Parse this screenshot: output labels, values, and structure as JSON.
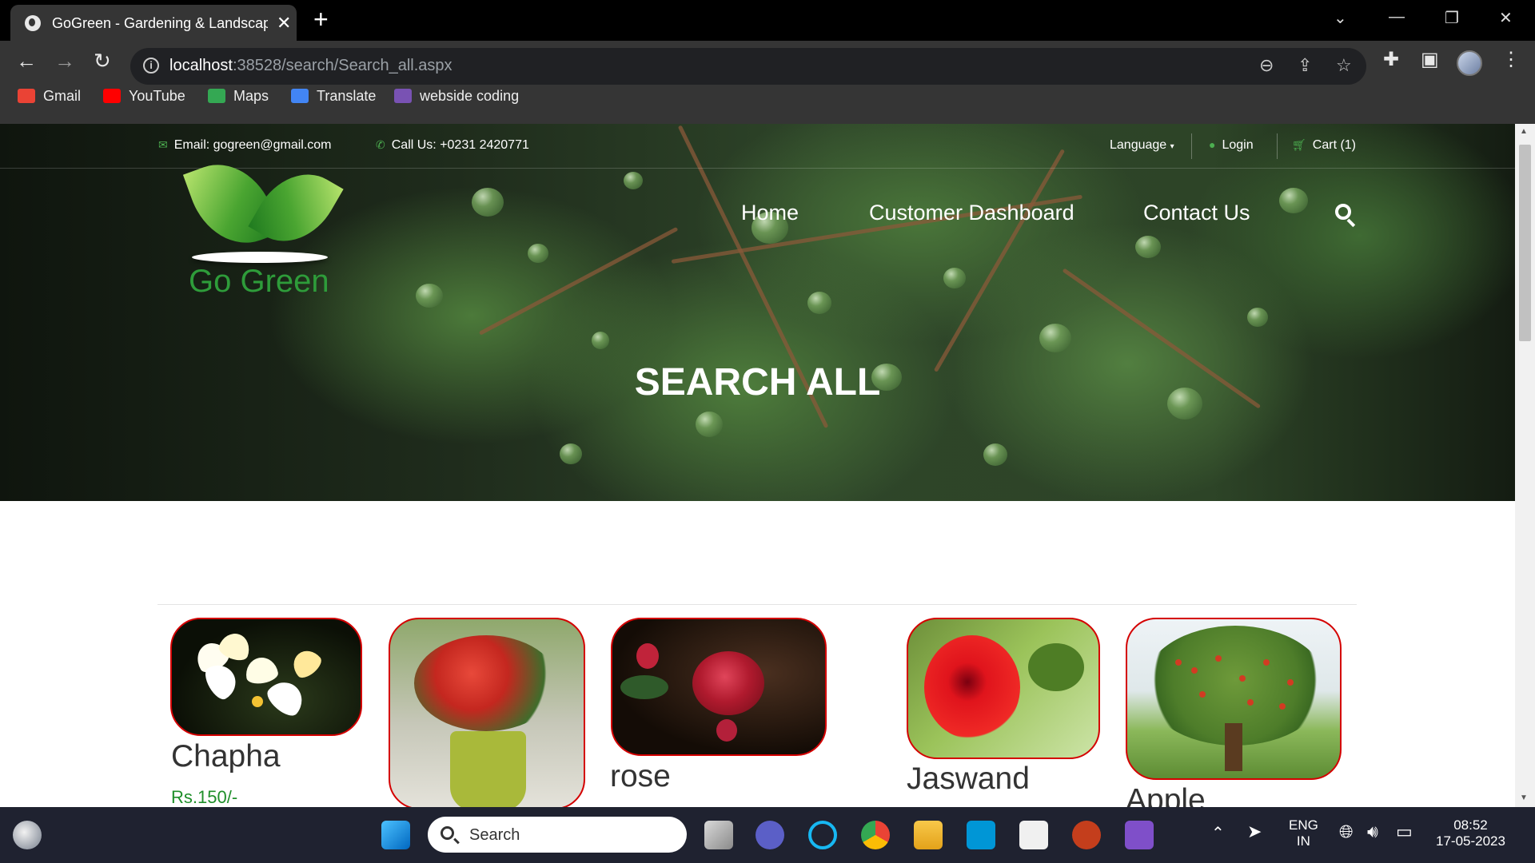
{
  "browser": {
    "tab_title": "GoGreen - Gardening & Landscap",
    "url_host": "localhost",
    "url_path": ":38528/search/Search_all.aspx",
    "bookmarks": [
      {
        "label": "Gmail",
        "icon": "gmail-icon",
        "color": "#ea4335"
      },
      {
        "label": "YouTube",
        "icon": "youtube-icon",
        "color": "#ff0000"
      },
      {
        "label": "Maps",
        "icon": "maps-icon",
        "color": "#34a853"
      },
      {
        "label": "Translate",
        "icon": "translate-icon",
        "color": "#4285f4"
      },
      {
        "label": "webside coding",
        "icon": "bootstrap-icon",
        "color": "#7952b3"
      }
    ]
  },
  "site": {
    "topbar": {
      "email": "Email: gogreen@gmail.com",
      "phone": "Call Us: +0231 2420771",
      "language": "Language",
      "login": "Login",
      "cart": "Cart (1)"
    },
    "logo_text": "Go Green",
    "nav": [
      "Home",
      "Customer Dashboard",
      "Contact Us"
    ],
    "hero_title": "SEARCH ALL",
    "accent": "#2e9c3a",
    "products": [
      {
        "name": "Chapha",
        "price": "Rs.150/-"
      },
      {
        "name": "",
        "price": ""
      },
      {
        "name": "rose",
        "price": ""
      },
      {
        "name": "Jaswand",
        "price": ""
      },
      {
        "name": "Apple",
        "price": ""
      }
    ]
  },
  "taskbar": {
    "search_label": "Search",
    "lang_top": "ENG",
    "lang_bottom": "IN",
    "time": "08:52",
    "date": "17-05-2023"
  }
}
